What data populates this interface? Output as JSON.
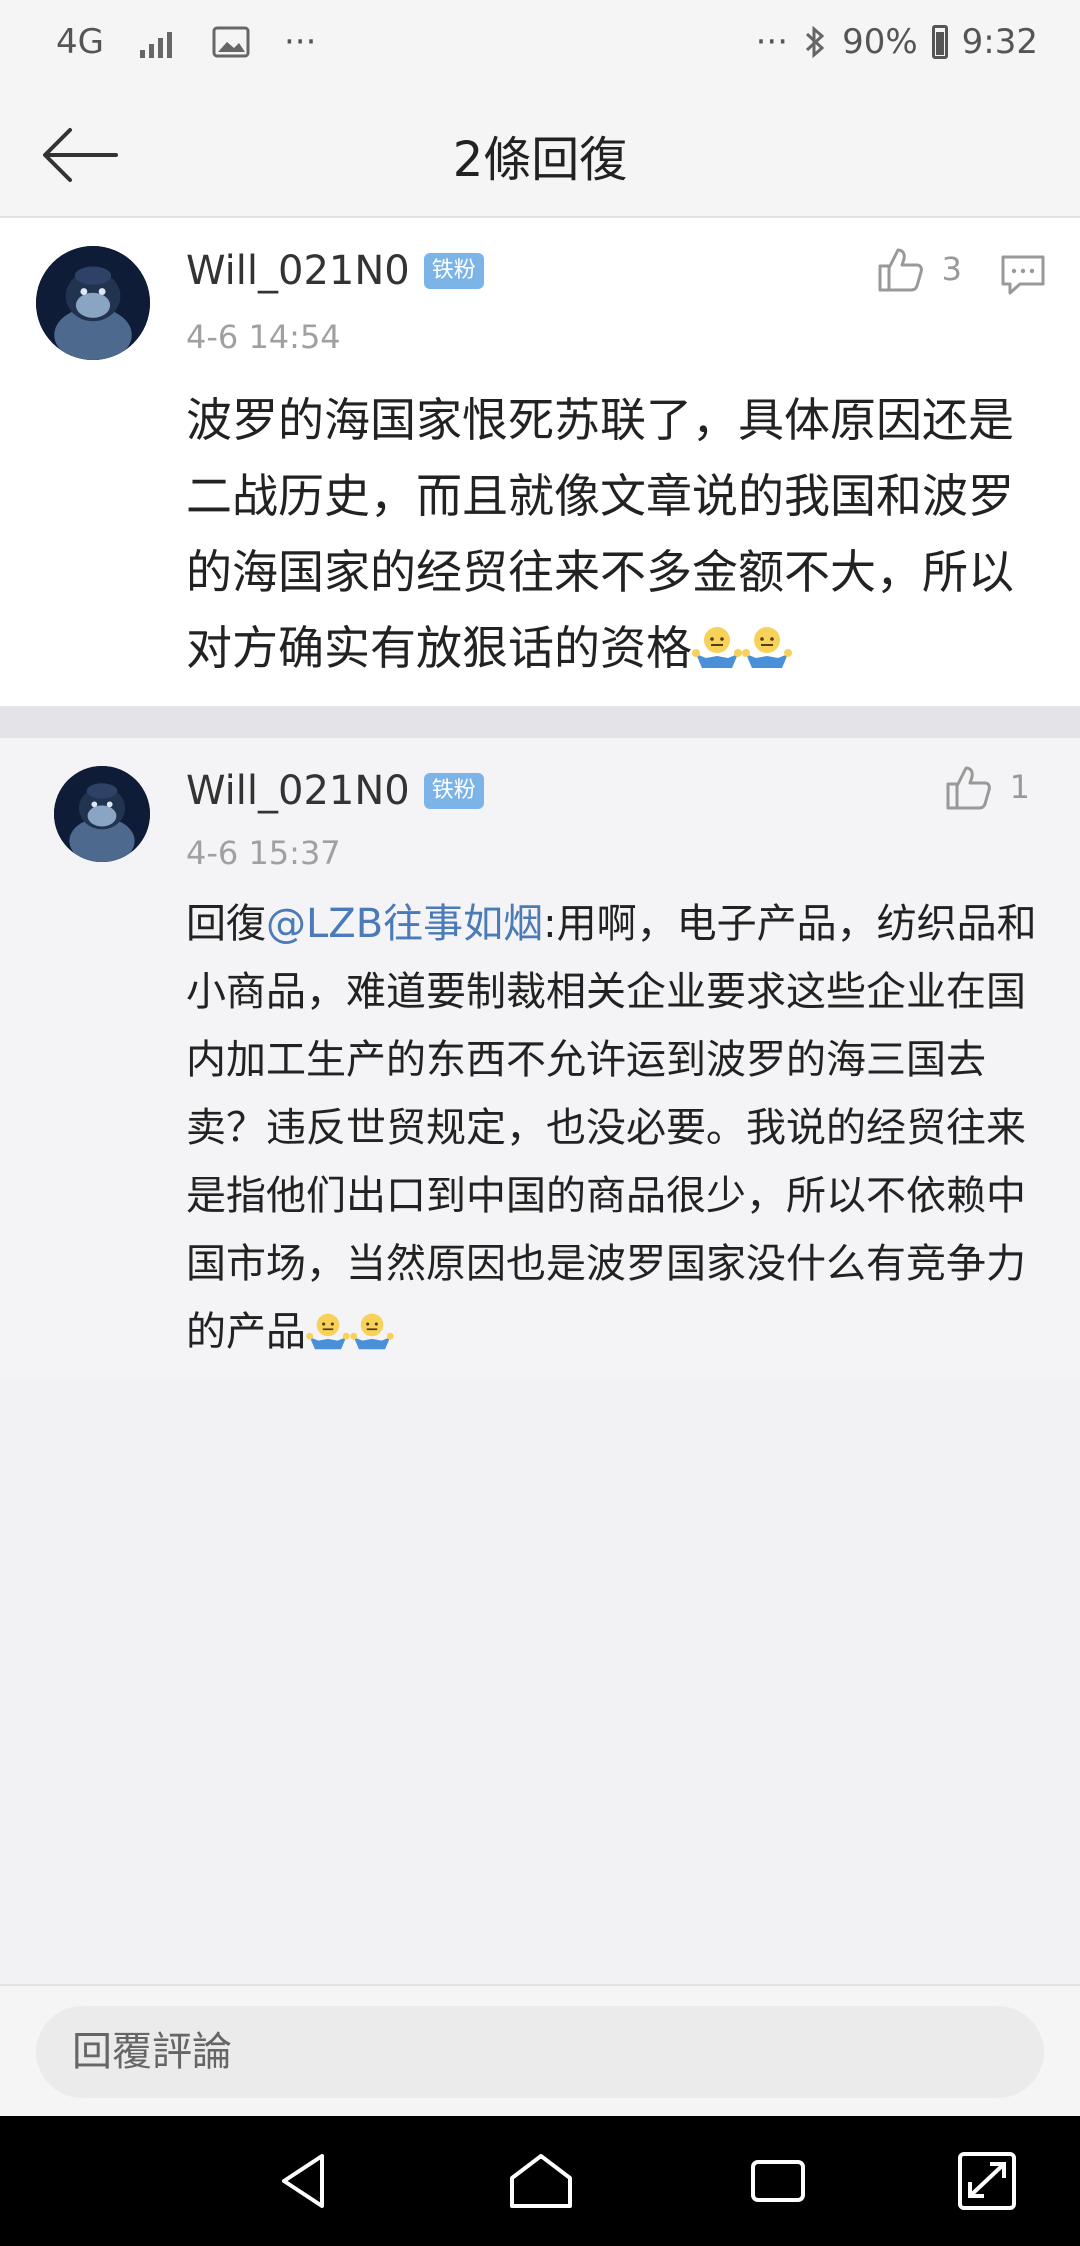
{
  "status_bar": {
    "network": "4G",
    "more_left": "···",
    "more_right": "···",
    "battery": "90%",
    "time": "9:32"
  },
  "header": {
    "title": "2條回復"
  },
  "comments": [
    {
      "username": "Will_021N0",
      "badge": "铁粉",
      "timestamp": "4-6 14:54",
      "likes": "3",
      "text": "波罗的海国家恨死苏联了，具体原因还是二战历史，而且就像文章说的我国和波罗的海国家的经贸往来不多金额不大，所以对方确实有放狠话的资格"
    },
    {
      "username": "Will_021N0",
      "badge": "铁粉",
      "timestamp": "4-6 15:37",
      "likes": "1",
      "reply_prefix": "回復",
      "mention": "@LZB往事如烟",
      "text": ":用啊，电子产品，纺织品和小商品，难道要制裁相关企业要求这些企业在国内加工生产的东西不允许运到波罗的海三国去卖？违反世贸规定，也没必要。我说的经贸往来是指他们出口到中国的商品很少，所以不依赖中国市场，当然原因也是波罗国家没什么有竞争力的产品"
    }
  ],
  "reply_bar": {
    "placeholder": "回覆評論"
  },
  "colors": {
    "accent_link": "#4a7ab8",
    "badge": "#7cb4e8",
    "page_bg": "#f2f2f5"
  },
  "icons": [
    "back-arrow-icon",
    "thumbs-up-icon",
    "comment-icon",
    "shrug-emoji-icon",
    "nav-back-icon",
    "nav-home-icon",
    "nav-recents-icon",
    "nav-expand-icon"
  ]
}
